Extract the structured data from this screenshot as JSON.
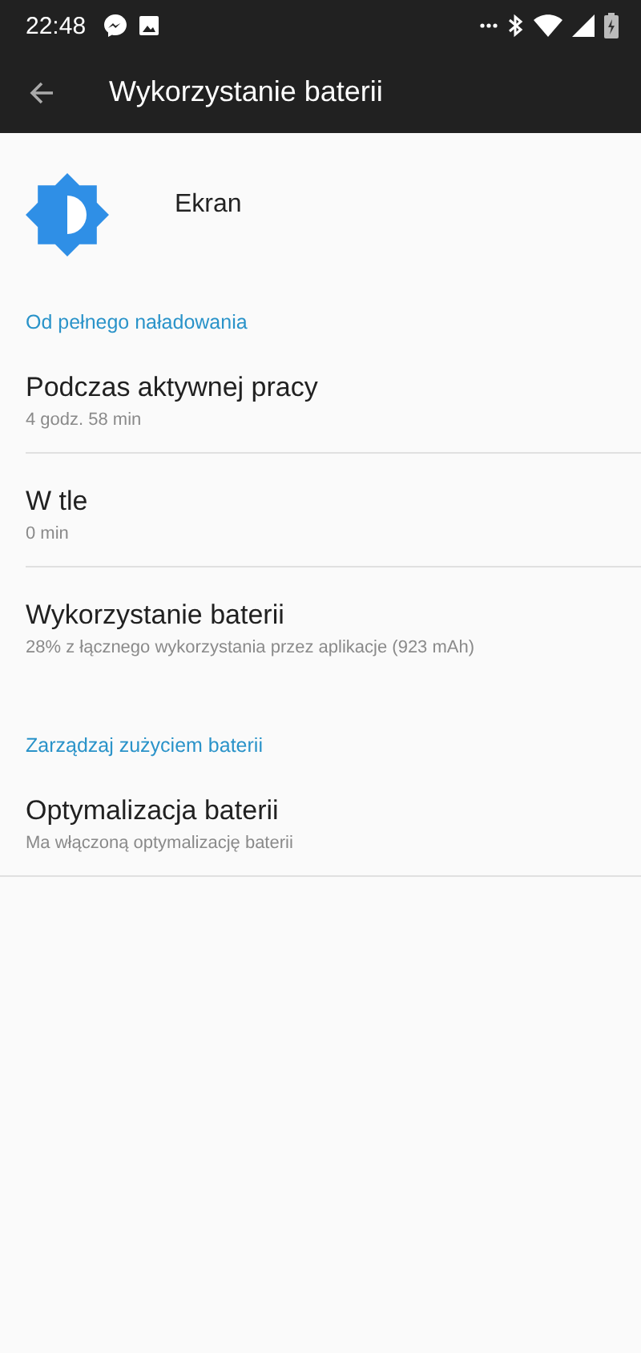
{
  "status_bar": {
    "time": "22:48"
  },
  "toolbar": {
    "title": "Wykorzystanie baterii"
  },
  "app_header": {
    "name": "Ekran"
  },
  "sections": [
    {
      "title": "Od pełnego naładowania",
      "items": [
        {
          "title": "Podczas aktywnej pracy",
          "subtitle": "4 godz. 58 min"
        },
        {
          "title": "W tle",
          "subtitle": "0 min"
        },
        {
          "title": "Wykorzystanie baterii",
          "subtitle": "28% z łącznego wykorzystania przez aplikacje (923 mAh)"
        }
      ]
    },
    {
      "title": "Zarządzaj zużyciem baterii",
      "items": [
        {
          "title": "Optymalizacja baterii",
          "subtitle": "Ma włączoną optymalizację baterii"
        }
      ]
    }
  ]
}
